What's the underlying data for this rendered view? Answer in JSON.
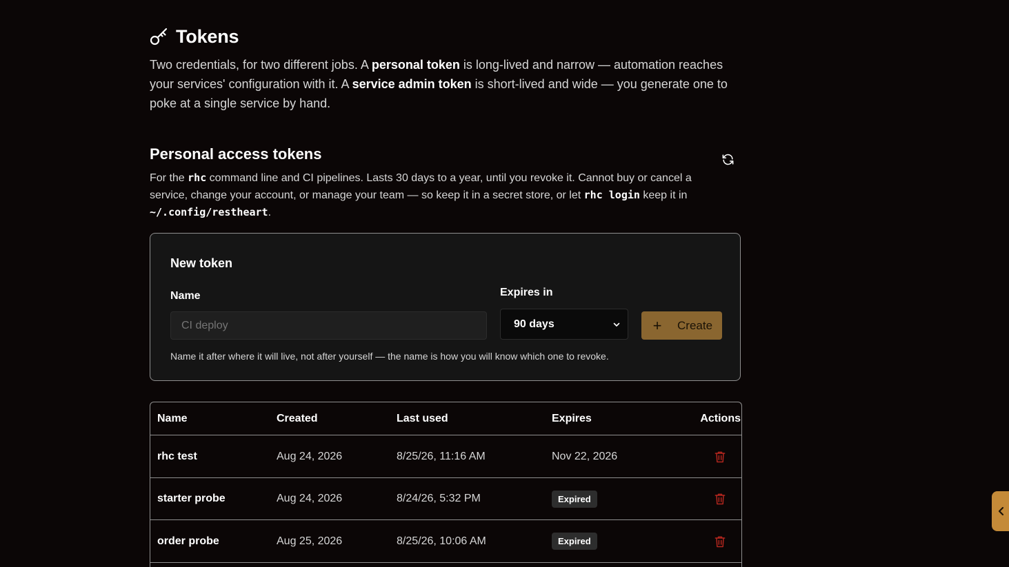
{
  "header": {
    "icon": "key-icon",
    "title": "Tokens"
  },
  "intro": {
    "part1": "Two credentials, for two different jobs. A ",
    "personal_token": "personal token",
    "part2": " is long-lived and narrow — automation reaches your services' configuration with it. A ",
    "service_admin_token": "service admin token",
    "part3": " is short-lived and wide — you generate one to poke at a single service by hand."
  },
  "personal_section": {
    "title": "Personal access tokens",
    "refresh_icon": "refresh-icon",
    "desc": {
      "part1": "For the ",
      "code1": "rhc",
      "part2": " command line and CI pipelines. Lasts 30 days to a year, until you revoke it. Cannot buy or cancel a service, change your account, or manage your team — so keep it in a secret store, or let ",
      "code2": "rhc login",
      "part3": " keep it in ",
      "code3": "~/.config/restheart",
      "part4": "."
    }
  },
  "new_token": {
    "title": "New token",
    "name_label": "Name",
    "name_placeholder": "CI deploy",
    "name_value": "",
    "expires_label": "Expires in",
    "expires_value": "90 days",
    "create_label": "Create",
    "hint": "Name it after where it will live, not after yourself — the name is how you will know which one to revoke."
  },
  "table": {
    "columns": [
      "Name",
      "Created",
      "Last used",
      "Expires",
      "Actions"
    ],
    "rows": [
      {
        "name": "rhc test",
        "created": "Aug 24, 2026",
        "last_used": "8/25/26, 11:16 AM",
        "expires": "Nov 22, 2026",
        "expired": false
      },
      {
        "name": "starter probe",
        "created": "Aug 24, 2026",
        "last_used": "8/24/26, 5:32 PM",
        "expires": "Expired",
        "expired": true
      },
      {
        "name": "order probe",
        "created": "Aug 25, 2026",
        "last_used": "8/25/26, 10:06 AM",
        "expires": "Expired",
        "expired": true
      }
    ]
  },
  "colors": {
    "background": "#0b0606",
    "accent": "#8a6630",
    "side_tab": "#c48a38",
    "danger": "#b3261e"
  }
}
